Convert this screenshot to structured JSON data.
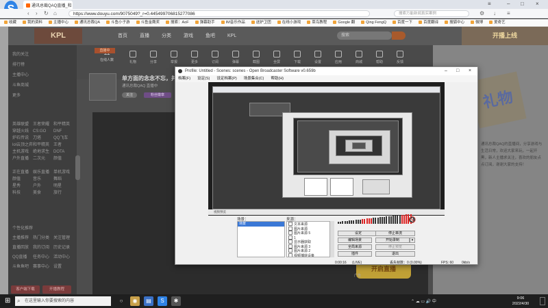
{
  "browser": {
    "tab_title": "通讯总裁QAQ直播_和",
    "url": "https://www.douyu.com/9075049?_r=0.445499706815277086",
    "search_placeholder": "搜索万能新闻真实案例",
    "bookmarks": [
      "收藏",
      "我的资料",
      "主播中心",
      "通讯总裁QA",
      "斗鱼小子游",
      "斗鱼金鹰奖",
      "搜索：AoF",
      "弹幕助手",
      "IM音乐作品",
      "送护卫团",
      "在线小游戏",
      "菜鸟教程",
      "Google 翻",
      "Qing FengQ",
      "百度一下",
      "百度翻译",
      "搜狐中心",
      "微博",
      "爱奇艺"
    ],
    "window_controls": [
      "–",
      "□",
      "×"
    ]
  },
  "site": {
    "logo_text": "KPL",
    "nav": [
      "首页",
      "直播",
      "分类",
      "游戏",
      "鱼吧",
      "KPL"
    ],
    "search_placeholder": "搜索",
    "banner_text": "开播上线",
    "sidebar_items": [
      "我的关注",
      "排行榜",
      "主播中心",
      "斗鱼商城",
      "更多"
    ],
    "sidebar_groups": [
      [
        "英雄联盟",
        "王者荣耀",
        "和平精英"
      ],
      [
        "穿越火线",
        "CS:GO",
        "DNF"
      ],
      [
        "炉石传说",
        "刀塔",
        "QQ飞车"
      ],
      [
        "lol云顶之弈",
        "和平精英",
        "王者"
      ],
      [
        "主机游戏",
        "绝地求生",
        "DOTA"
      ],
      [
        "户外直播",
        "二次元",
        "颜值"
      ]
    ],
    "sidebar_groups2": [
      [
        "正在直播",
        "娱乐直播",
        "单机游戏"
      ],
      [
        "颜值",
        "音乐",
        "舞蹈"
      ],
      [
        "星秀",
        "户外",
        "明星"
      ],
      [
        "科技",
        "美食",
        "旅行"
      ]
    ],
    "sidebar_section3": "个性化推荐",
    "sidebar_groups3": [
      [
        "主播推荐",
        "热门分类",
        "关注管理"
      ],
      [
        "直播回放",
        "我的订阅",
        "历史记录"
      ],
      [
        "QQ直播",
        "任务中心",
        "活动中心"
      ],
      [
        "斗鱼鱼吧",
        "赛事中心",
        "设置"
      ]
    ],
    "sidebar_btn1": "客户端下载",
    "sidebar_btn2": "开播教程",
    "top_count": "11",
    "top_count_label": "在线人数",
    "top_badge": "直播中",
    "top_icons": [
      "礼物",
      "分享",
      "举报",
      "更多",
      "订阅",
      "弹幕",
      "截图",
      "全屏",
      "下载",
      "设置",
      "应用",
      "商城",
      "帮助",
      "反馈"
    ],
    "streamer_title": "单方面的念念不忘，并",
    "streamer_sub": "通讯总裁QAQ  直播中",
    "follow_label": "关注",
    "chip_label": "粉丝徽章",
    "right_text": "通讯总裁QAQ的直播间，分享游戏与生活日常，欢迎大家来玩，一起开黑，新人主播求关注，喜欢的朋友点点订阅，谢谢大家的支持！",
    "promo_text": "礼物",
    "ad_label": "广告",
    "ad_promo": "开启直播"
  },
  "obs": {
    "title": "Profile: Untitled - Scenes: scenes - Open Broadcaster Software v0.659b",
    "menu": [
      "档案(F)",
      "设定(S)",
      "设定档案(P)",
      "场景集合(C)",
      "帮助(H)"
    ],
    "scenes_label": "场景：",
    "sources_label": "来源：",
    "scenes": [
      "场景"
    ],
    "sources": [
      "文本来源",
      "图片来源",
      "图片来源 5",
      "1",
      "显示器获取",
      "图片来源 3",
      "图片来源 2",
      "视频捕获设备"
    ],
    "buttons": {
      "settings": "设定",
      "stop_stream": "停止串流",
      "edit_scene": "编辑场景",
      "start_record": "开始录制",
      "global_sources": "全局来源",
      "preview": "停止预览",
      "plugins": "插件",
      "exit": "退出"
    },
    "status": {
      "time": "0:00:16",
      "live_label": "(LIVE)",
      "dropped": "丢失帧数：0 (0.00%)",
      "fps": "FPS: 60",
      "bitrate": "0kb/s"
    },
    "bottom_strip": "视频预览"
  },
  "taskbar": {
    "search_placeholder": "在这里输入你要搜索的内容",
    "tray": "⌃  ☁  ▭  🔊  中",
    "time": "9:06",
    "date": "2022/4/30"
  }
}
